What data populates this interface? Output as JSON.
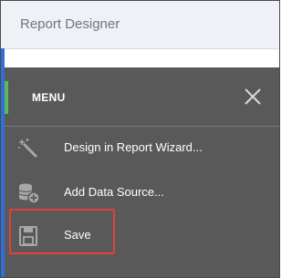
{
  "window": {
    "title": "Report Designer"
  },
  "menu": {
    "title": "MENU",
    "close_icon": "close-icon",
    "items": [
      {
        "label": "Design in Report Wizard...",
        "icon": "magic-wand-icon"
      },
      {
        "label": "Add Data Source...",
        "icon": "add-database-icon"
      },
      {
        "label": "Save",
        "icon": "floppy-save-icon"
      }
    ]
  },
  "colors": {
    "panel_bg": "#595959",
    "title_bar_bg": "#eef1f5",
    "accent_blue": "#2f6fd6",
    "accent_green": "#5cb85c",
    "highlight_red": "#e0403e",
    "icon_gray": "#a8a8a8"
  }
}
